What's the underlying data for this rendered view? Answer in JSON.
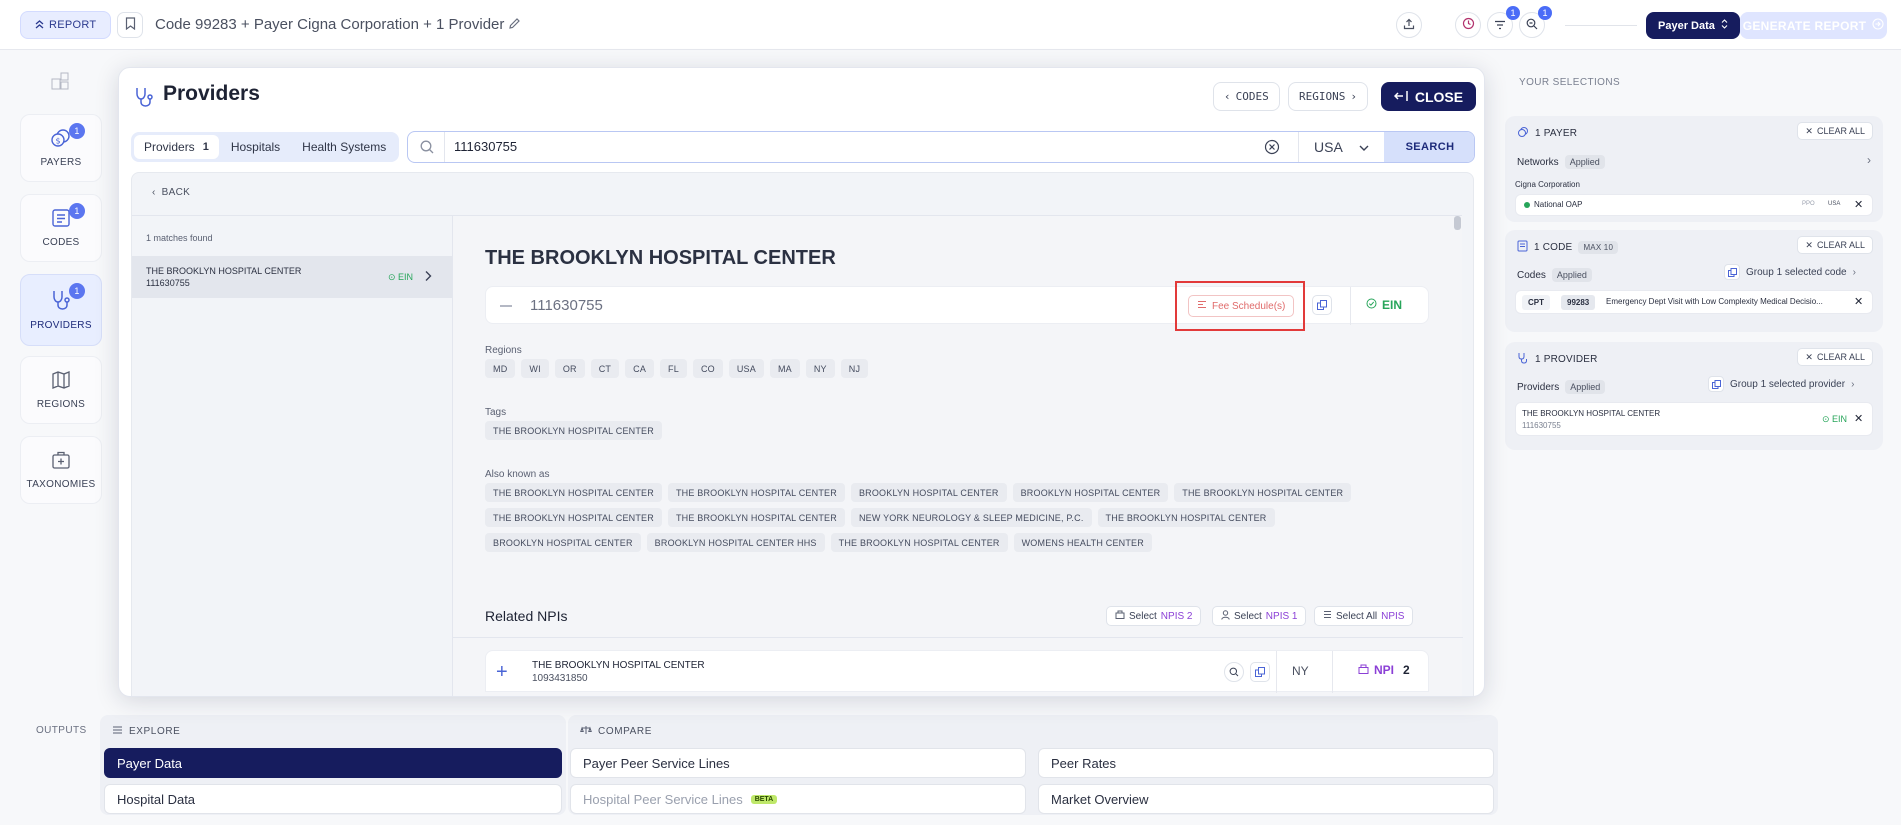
{
  "header": {
    "report_label": "REPORT",
    "title": "Code 99283 + Payer Cigna Corporation + 1 Provider",
    "filter_badge": "1",
    "zoom_badge": "1",
    "payer_data_label": "Payer Data",
    "generate_label": "GENERATE REPORT"
  },
  "nav": {
    "payers": {
      "label": "PAYERS",
      "badge": "1"
    },
    "codes": {
      "label": "CODES",
      "badge": "1"
    },
    "providers": {
      "label": "PROVIDERS",
      "badge": "1"
    },
    "regions": {
      "label": "REGIONS"
    },
    "taxonomies": {
      "label": "TAXONOMIES"
    }
  },
  "modal": {
    "title": "Providers",
    "codes_btn": "CODES",
    "regions_btn": "REGIONS",
    "close_btn": "CLOSE",
    "tabs": [
      {
        "label": "Providers",
        "count": "1"
      },
      {
        "label": "Hospitals"
      },
      {
        "label": "Health Systems"
      }
    ],
    "search": {
      "value": "111630755",
      "country": "USA",
      "button": "SEARCH"
    },
    "back_label": "BACK",
    "matches": "1 matches found",
    "result": {
      "name": "THE BROOKLYN HOSPITAL CENTER",
      "id": "111630755",
      "badge": "EIN"
    },
    "detail": {
      "title": "THE BROOKLYN HOSPITAL CENTER",
      "id": "111630755",
      "fee_schedule": "Fee Schedule(s)",
      "id_type": "EIN",
      "regions_label": "Regions",
      "regions": [
        "MD",
        "WI",
        "OR",
        "CT",
        "CA",
        "FL",
        "CO",
        "USA",
        "MA",
        "NY",
        "NJ"
      ],
      "tags_label": "Tags",
      "tags": [
        "THE BROOKLYN HOSPITAL CENTER"
      ],
      "aka_label": "Also known as",
      "aka": [
        "THE BROOKLYN HOSPITAL CENTER",
        "THE BROOKLYN HOSPITAL CENTER",
        "BROOKLYN HOSPITAL CENTER",
        "BROOKLYN HOSPITAL CENTER",
        "THE BROOKLYN HOSPITAL CENTER",
        "THE BROOKLYN HOSPITAL CENTER",
        "THE BROOKLYN HOSPITAL CENTER",
        "NEW YORK NEUROLOGY & SLEEP MEDICINE, P.C.",
        "THE BROOKLYN HOSPITAL CENTER",
        "BROOKLYN HOSPITAL CENTER",
        "BROOKLYN HOSPITAL CENTER HHS",
        "THE BROOKLYN HOSPITAL CENTER",
        "WOMENS HEALTH CENTER"
      ],
      "related_title": "Related NPIs",
      "select_npis_2": {
        "pre": "Select ",
        "hl": "NPIS 2"
      },
      "select_npis_1": {
        "pre": "Select ",
        "hl": "NPIS 1"
      },
      "select_all": {
        "pre": "Select All ",
        "hl": "NPIS"
      },
      "npi": {
        "name": "THE BROOKLYN HOSPITAL CENTER",
        "number": "1093431850",
        "state": "NY",
        "badge": "NPI",
        "count": "2"
      }
    }
  },
  "selections": {
    "title": "YOUR SELECTIONS",
    "clear_all": "CLEAR ALL",
    "applied": "Applied",
    "payer": {
      "head": "1 PAYER",
      "networks": "Networks",
      "org": "Cigna Corporation",
      "network": "National OAP",
      "tag1": "PPO",
      "tag2": "USA"
    },
    "code": {
      "head": "1 CODE",
      "max": "MAX 10",
      "codes": "Codes",
      "group": "Group 1 selected code",
      "type": "CPT",
      "code": "99283",
      "desc": "Emergency Dept Visit with Low Complexity Medical Decisio..."
    },
    "provider": {
      "head": "1 PROVIDER",
      "providers": "Providers",
      "group": "Group 1 selected provider",
      "name": "THE BROOKLYN HOSPITAL CENTER",
      "id": "111630755",
      "badge": "EIN"
    }
  },
  "outputs": {
    "label": "OUTPUTS",
    "explore": "EXPLORE",
    "compare": "COMPARE",
    "payer_data": "Payer Data",
    "hospital_data": "Hospital Data",
    "payer_peer": "Payer Peer Service Lines",
    "hospital_peer": "Hospital Peer Service Lines",
    "beta": "BETA",
    "peer_rates": "Peer Rates",
    "market_overview": "Market Overview"
  }
}
